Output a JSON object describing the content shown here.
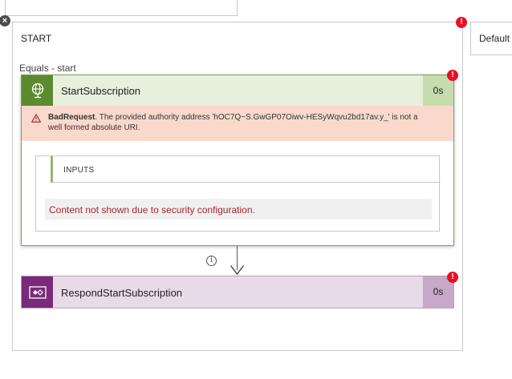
{
  "top_close": {
    "glyph": "×"
  },
  "switch_case": {
    "title": "START",
    "condition": "Equals - start",
    "error_glyph": "!"
  },
  "default_case": {
    "title": "Default"
  },
  "start_subscription": {
    "title": "StartSubscription",
    "duration": "0s",
    "error_glyph": "!",
    "header_color": "#5c8a2e",
    "error": {
      "code": "BadRequest",
      "message": ". The provided authority address 'hOC7Q~S.GwGP07Oiwv-HESyWqvu2bd17av.y_' is not a well formed absolute URI."
    },
    "inputs": {
      "label": "INPUTS",
      "secure_message": "Content not shown due to security configuration."
    }
  },
  "connector": {
    "info_glyph": "i"
  },
  "respond_start_subscription": {
    "title": "RespondStartSubscription",
    "duration": "0s",
    "error_glyph": "!",
    "header_color": "#7a2a7a"
  },
  "icons": {
    "start_action": "globe-icon",
    "respond_action": "request-response-icon",
    "error": "error-badge-icon",
    "warning": "warning-icon",
    "info": "info-icon"
  }
}
